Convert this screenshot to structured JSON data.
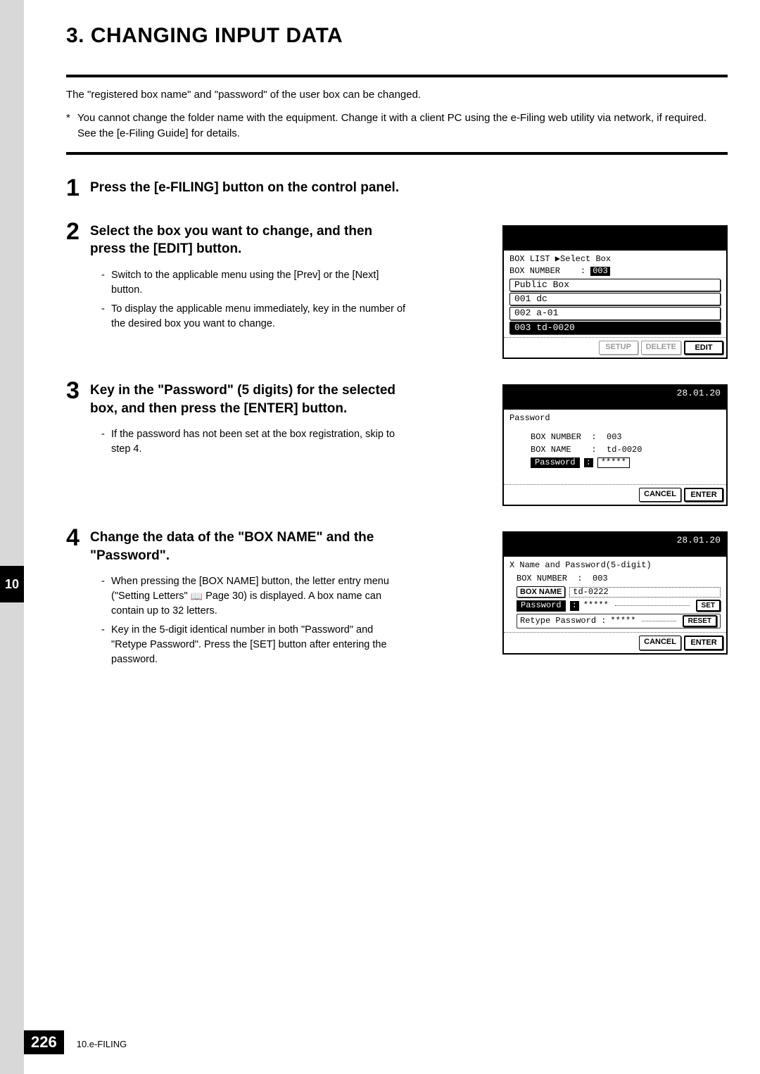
{
  "section_title": "3. CHANGING INPUT DATA",
  "intro": "The \"registered box name\" and \"password\" of the user box can be changed.",
  "note": "You cannot change the folder name with the equipment. Change it with a client PC using the e-Filing web utility via network, if required. See the [e-Filing Guide] for details.",
  "steps": {
    "s1": {
      "num": "1",
      "title": "Press the [e-FILING] button on the control panel."
    },
    "s2": {
      "num": "2",
      "title": "Select the box you want to change, and then press the [EDIT] button.",
      "b1": "Switch to the applicable menu using the [Prev] or the [Next] button.",
      "b2": "To display the applicable menu immediately, key in the number of the desired box you want to change."
    },
    "s3": {
      "num": "3",
      "title": "Key in the \"Password\" (5 digits) for the selected box, and then press the [ENTER] button.",
      "b1": "If the password has not been set at the box registration, skip to step 4."
    },
    "s4": {
      "num": "4",
      "title": "Change the data of the \"BOX NAME\" and the \"Password\".",
      "b1a": "When pressing the [BOX NAME] button, the letter entry menu (\"Setting Letters\" ",
      "b1b": " Page 30) is displayed. A box name can contain up to 32 letters.",
      "b2": "Key in the 5-digit identical number in both \"Password\" and \"Retype Password\". Press the [SET] button after entering the password."
    }
  },
  "lcd1": {
    "breadcrumb": "BOX LIST  ▶Select Box",
    "boxnum_label": "BOX NUMBER",
    "boxnum_val": "003",
    "row_pub": "   Public Box",
    "row1": "001 dc",
    "row2": "002 a-01",
    "row3": "003 td-0020",
    "btn_setup": "SETUP",
    "btn_delete": "DELETE",
    "btn_edit": "EDIT"
  },
  "lcd2": {
    "date": "28.01.20",
    "heading": "Password",
    "boxnum_label": "BOX NUMBER",
    "boxnum_val": "003",
    "boxname_label": "BOX NAME",
    "boxname_val": "td-0020",
    "pw_label": "Password",
    "pw_val": "*****",
    "btn_cancel": "CANCEL",
    "btn_enter": "ENTER"
  },
  "lcd3": {
    "date": "28.01.20",
    "heading": "X Name and Password(5-digit)",
    "boxnum_label": "BOX NUMBER",
    "boxnum_val": "003",
    "boxname_btn": "BOX NAME",
    "boxname_val": "td-0222",
    "pw_label": "Password",
    "pw_val": "*****",
    "retype_label": "Retype Password :",
    "retype_val": "*****",
    "btn_set": "SET",
    "btn_reset": "RESET",
    "btn_cancel": "CANCEL",
    "btn_enter": "ENTER"
  },
  "chapter_tab": "10",
  "footer": {
    "page": "226",
    "chapter": "10.e-FILING"
  }
}
